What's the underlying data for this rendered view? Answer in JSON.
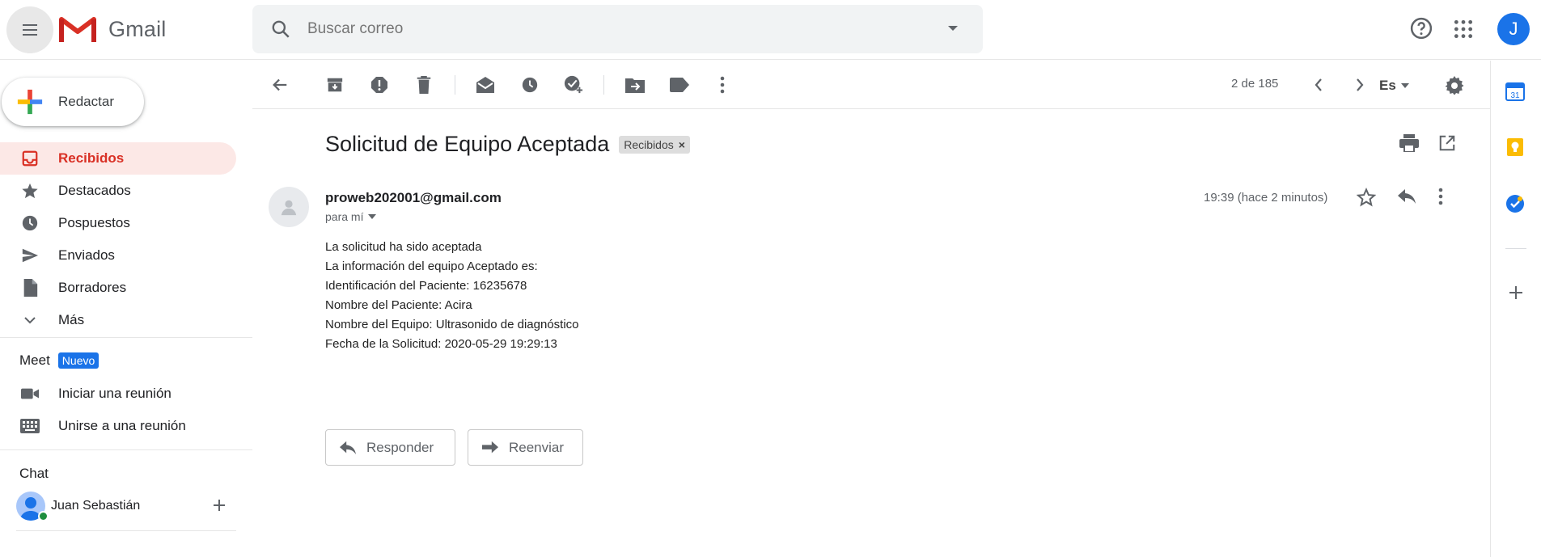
{
  "app": {
    "name": "Gmail",
    "account_initial": "J",
    "colors": {
      "accent": "#d93025",
      "primary": "#1a73e8",
      "active_bg": "#fce8e6"
    }
  },
  "search": {
    "placeholder": "Buscar correo"
  },
  "compose": {
    "label": "Redactar"
  },
  "sidebar": {
    "items": [
      {
        "label": "Recibidos",
        "icon": "inbox-icon",
        "active": true
      },
      {
        "label": "Destacados",
        "icon": "star-icon"
      },
      {
        "label": "Pospuestos",
        "icon": "clock-icon"
      },
      {
        "label": "Enviados",
        "icon": "send-icon"
      },
      {
        "label": "Borradores",
        "icon": "draft-icon"
      },
      {
        "label": "Más",
        "icon": "chevron-down-icon"
      }
    ],
    "meet": {
      "title": "Meet",
      "badge": "Nuevo",
      "items": [
        {
          "label": "Iniciar una reunión",
          "icon": "video-icon"
        },
        {
          "label": "Unirse a una reunión",
          "icon": "keyboard-icon"
        }
      ]
    },
    "chat": {
      "title": "Chat",
      "contact": "Juan Sebastián"
    }
  },
  "toolbar": {
    "pager": "2 de 185",
    "language": "Es"
  },
  "email": {
    "subject": "Solicitud de Equipo Aceptada",
    "label": "Recibidos",
    "label_close": "×",
    "sender": "proweb202001@gmail.com",
    "to": "para mí",
    "time": "19:39 (hace 2 minutos)",
    "body": [
      "La solicitud ha sido aceptada",
      "La información del equipo Aceptado es:",
      "Identificación del Paciente: 16235678",
      "Nombre del Paciente: Acira",
      "Nombre del Equipo: Ultrasonido de diagnóstico",
      "Fecha de la Solicitud: 2020-05-29 19:29:13"
    ],
    "reply_label": "Responder",
    "forward_label": "Reenviar"
  }
}
